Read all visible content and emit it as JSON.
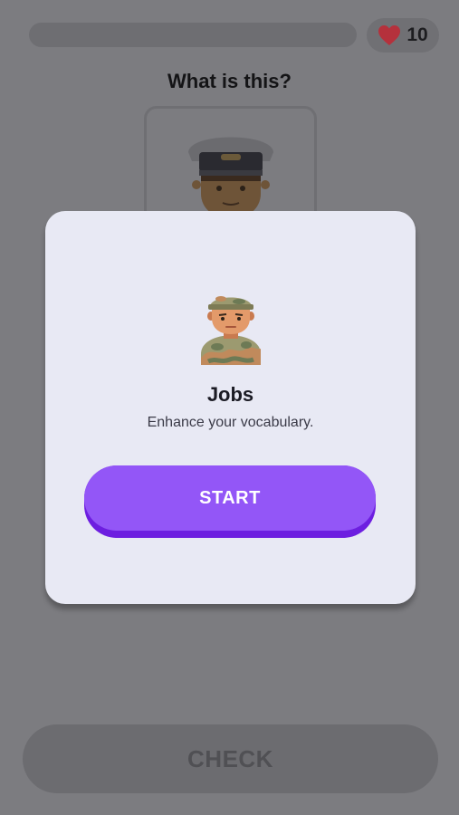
{
  "header": {
    "progress_fraction": 0,
    "hearts_count": "10",
    "heart_icon": "heart-icon"
  },
  "question": {
    "prompt": "What is this?",
    "image_icon": "captain-icon"
  },
  "footer": {
    "check_label": "CHECK"
  },
  "modal": {
    "icon": "soldier-icon",
    "title": "Jobs",
    "subtitle": "Enhance your vocabulary.",
    "start_label": "START"
  },
  "colors": {
    "heart": "#b5313c",
    "start_button": "#9356f7",
    "start_button_shadow": "#6d1ee0",
    "modal_background": "#e8e9f4"
  }
}
